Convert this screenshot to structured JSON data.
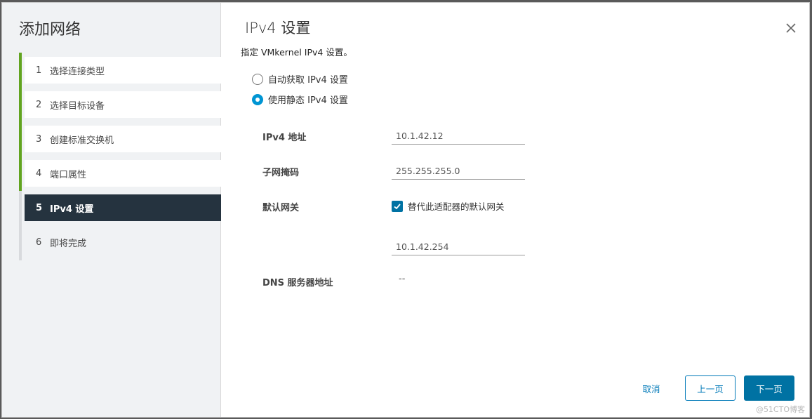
{
  "wizard": {
    "title": "添加网络",
    "steps": [
      {
        "num": "1",
        "label": "选择连接类型"
      },
      {
        "num": "2",
        "label": "选择目标设备"
      },
      {
        "num": "3",
        "label": "创建标准交换机"
      },
      {
        "num": "4",
        "label": "端口属性"
      },
      {
        "num": "5",
        "label": "IPv4 设置"
      },
      {
        "num": "6",
        "label": "即将完成"
      }
    ]
  },
  "page": {
    "title": "IPv4 设置",
    "subtitle": "指定 VMkernel IPv4 设置。",
    "radio_auto": "自动获取 IPv4 设置",
    "radio_static": "使用静态 IPv4 设置",
    "ipv4_label": "IPv4 地址",
    "ipv4_value": "10.1.42.12",
    "mask_label": "子网掩码",
    "mask_value": "255.255.255.0",
    "gateway_label": "默认网关",
    "gateway_override": "替代此适配器的默认网关",
    "gateway_value": "10.1.42.254",
    "dns_label": "DNS 服务器地址",
    "dns_value": "--"
  },
  "buttons": {
    "cancel": "取消",
    "prev": "上一页",
    "next": "下一页"
  },
  "watermark": "@51CTO博客",
  "colors": {
    "active_step": "#25333f",
    "done_rail": "#62a420",
    "primary": "#0072a3",
    "link": "#0079b8"
  }
}
